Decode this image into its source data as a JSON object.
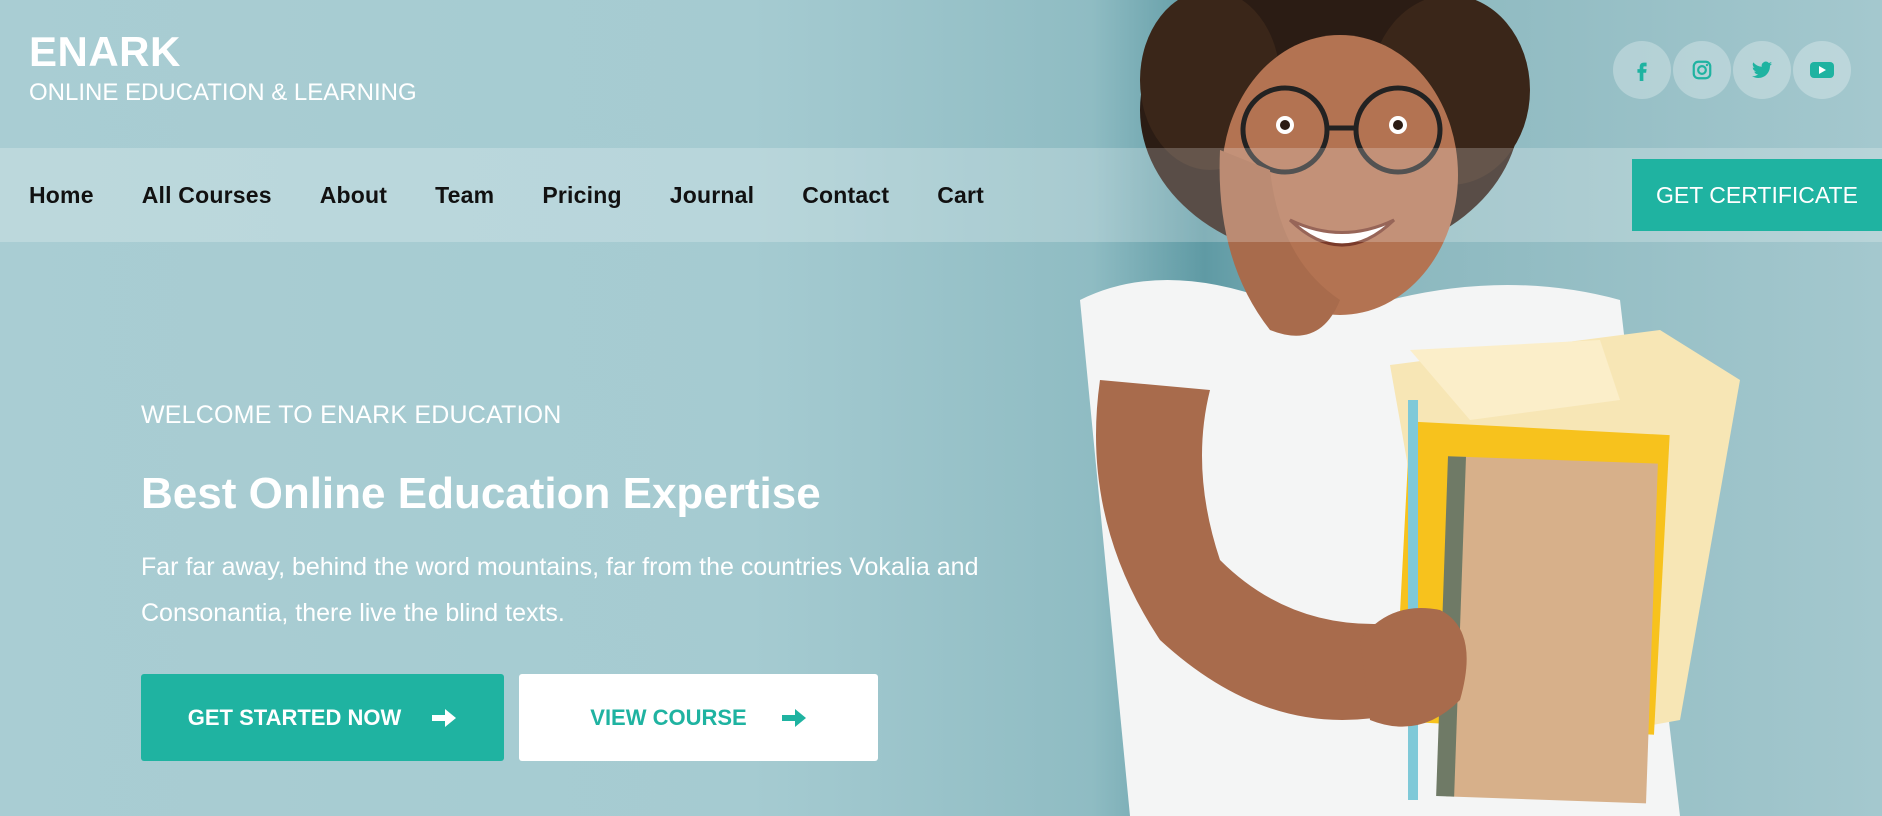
{
  "brand": {
    "name": "ENARK",
    "tagline": "ONLINE EDUCATION & LEARNING"
  },
  "social": [
    {
      "icon": "facebook-icon"
    },
    {
      "icon": "instagram-icon"
    },
    {
      "icon": "twitter-icon"
    },
    {
      "icon": "youtube-icon"
    }
  ],
  "nav": {
    "items": [
      "Home",
      "All Courses",
      "About",
      "Team",
      "Pricing",
      "Journal",
      "Contact",
      "Cart"
    ],
    "cta_label": "GET CERTIFICATE"
  },
  "hero": {
    "welcome": "WELCOME TO ENARK EDUCATION",
    "headline": "Best Online Education Expertise",
    "description": "Far far away, behind the word mountains, far from the countries Vokalia and Consonantia, there live the blind texts.",
    "primary_button": "GET STARTED NOW",
    "secondary_button": "VIEW COURSE"
  },
  "colors": {
    "accent": "#1fb3a1",
    "background": "#a9cdd3",
    "text_light": "#ffffff",
    "nav_text": "#111111"
  }
}
